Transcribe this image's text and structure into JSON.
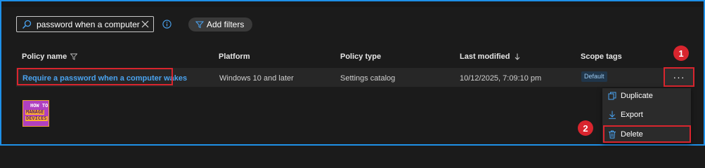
{
  "search": {
    "value": "password when a computer ...",
    "icon": "search-icon",
    "clear_icon": "close-icon"
  },
  "toolbar": {
    "add_filters_label": "Add filters"
  },
  "table": {
    "columns": [
      "Policy name",
      "Platform",
      "Policy type",
      "Last modified",
      "Scope tags"
    ],
    "rows": [
      {
        "policy_name": "Require a password when a computer wakes",
        "platform": "Windows 10 and later",
        "policy_type": "Settings catalog",
        "last_modified": "10/12/2025, 7:09:10 pm",
        "scope_tag": "Default",
        "more_label": "···"
      }
    ]
  },
  "menu": {
    "items": [
      {
        "label": "Duplicate",
        "icon": "duplicate-icon"
      },
      {
        "label": "Export",
        "icon": "download-icon"
      },
      {
        "label": "Delete",
        "icon": "trash-icon"
      }
    ]
  },
  "steps": {
    "step1": "1",
    "step2": "2"
  },
  "logo": {
    "line1": "HOW TO",
    "line2": "MANAGE",
    "line3": "DEVICES"
  },
  "colors": {
    "accent": "#4aa3f0",
    "highlight": "#d9252e",
    "frame": "#1e90e8",
    "background": "#1b1b1b"
  }
}
